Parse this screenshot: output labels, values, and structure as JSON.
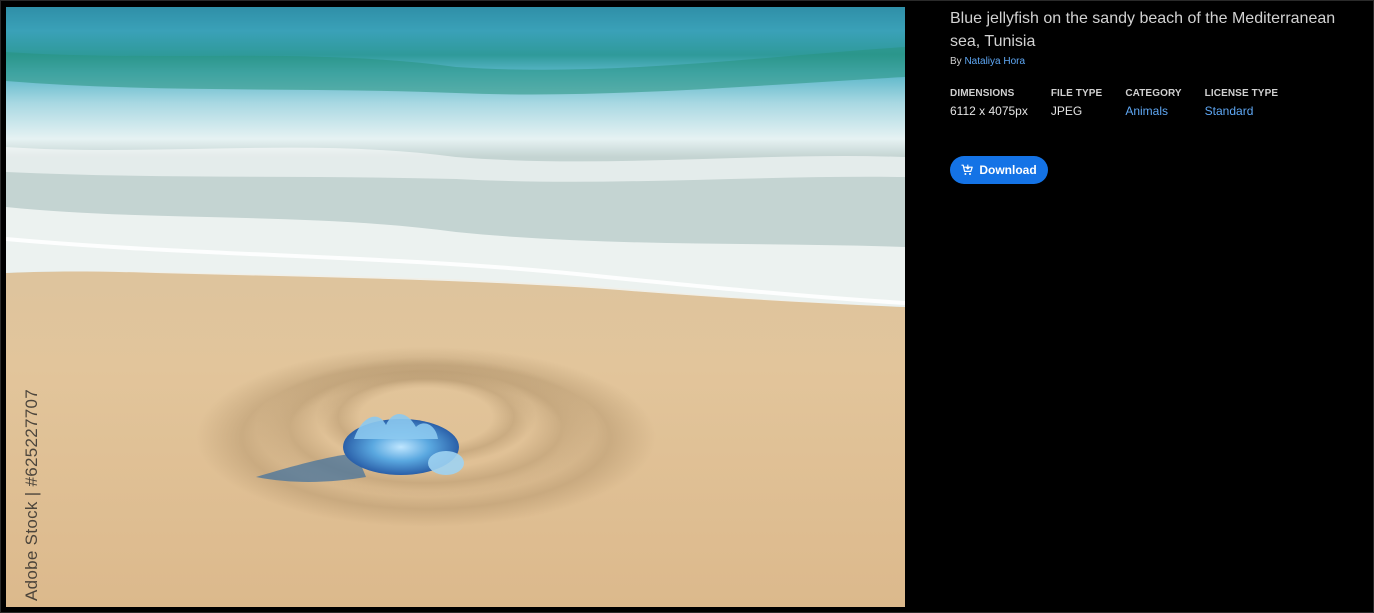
{
  "image": {
    "alt": "Blue jellyfish on the sandy beach of the Mediterranean sea, Tunisia",
    "watermark": "Adobe Stock | #625227707"
  },
  "details": {
    "title": "Blue jellyfish on the sandy beach of the Mediterranean sea, Tunisia",
    "by_prefix": "By",
    "author": "Nataliya Hora",
    "meta": [
      {
        "label": "DIMENSIONS",
        "value": "6112 x 4075px",
        "is_link": false
      },
      {
        "label": "FILE TYPE",
        "value": "JPEG",
        "is_link": false
      },
      {
        "label": "CATEGORY",
        "value": "Animals",
        "is_link": true
      },
      {
        "label": "LICENSE TYPE",
        "value": "Standard",
        "is_link": true
      }
    ],
    "download_label": "Download",
    "download_icon": "cart-download-icon"
  },
  "colors": {
    "background": "#000000",
    "accent": "#1473e6",
    "link": "#5fa8f5"
  }
}
